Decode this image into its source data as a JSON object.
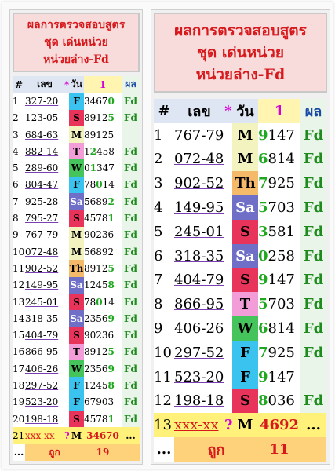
{
  "left": {
    "title_lines": [
      "ผลการตรวจสอบสูตร",
      "ชุด เด่นหน่วย",
      "หน่วยล่าง-Fd"
    ],
    "headers": {
      "no": "#",
      "lek": "เลข",
      "star": "*",
      "wan": "วัน",
      "num": "1",
      "pl": "ผล"
    },
    "rows": [
      {
        "no": "1",
        "lek": "327-20",
        "day": "F",
        "res_pre": "3467",
        "res_hit": "0",
        "res_post": "",
        "hit_color": "g",
        "pl": "Fd"
      },
      {
        "no": "2",
        "lek": "123-05",
        "day": "S",
        "res_pre": "8912",
        "res_hit": "5",
        "res_post": "",
        "hit_color": "g",
        "pl": "Fd"
      },
      {
        "no": "3",
        "lek": "684-63",
        "day": "M",
        "res_pre": "89125",
        "res_hit": "",
        "res_post": "",
        "hit_color": "g",
        "pl": ""
      },
      {
        "no": "4",
        "lek": "882-14",
        "day": "T",
        "res_pre": "1",
        "res_hit": "2",
        "res_post": "458",
        "hit_color": "g",
        "pl": "Fd"
      },
      {
        "no": "5",
        "lek": "289-60",
        "day": "W",
        "res_pre": "0",
        "res_hit": "1",
        "res_post": "347",
        "hit_color": "g",
        "pl": "Fd"
      },
      {
        "no": "6",
        "lek": "804-47",
        "day": "F",
        "res_pre": "78",
        "res_hit": "0",
        "res_post": "14",
        "hit_color": "g",
        "pl": "Fd"
      },
      {
        "no": "7",
        "lek": "925-28",
        "day": "Sa",
        "res_pre": "5689",
        "res_hit": "2",
        "res_post": "",
        "hit_color": "g",
        "pl": "Fd"
      },
      {
        "no": "8",
        "lek": "795-27",
        "day": "S",
        "res_pre": "4578",
        "res_hit": "1",
        "res_post": "",
        "hit_color": "g",
        "pl": "Fd"
      },
      {
        "no": "9",
        "lek": "767-79",
        "day": "M",
        "res_pre": "90236",
        "res_hit": "",
        "res_post": "",
        "hit_color": "g",
        "pl": "Fd"
      },
      {
        "no": "10",
        "lek": "072-48",
        "day": "M",
        "res_pre": "56892",
        "res_hit": "",
        "res_post": "",
        "hit_color": "g",
        "pl": "Fd"
      },
      {
        "no": "11",
        "lek": "902-52",
        "day": "Th",
        "res_pre": "8912",
        "res_hit": "5",
        "res_post": "",
        "hit_color": "g",
        "pl": "Fd"
      },
      {
        "no": "12",
        "lek": "149-95",
        "day": "Sa",
        "res_pre": "1245",
        "res_hit": "8",
        "res_post": "",
        "hit_color": "g",
        "pl": "Fd"
      },
      {
        "no": "13",
        "lek": "245-01",
        "day": "S",
        "res_pre": "78",
        "res_hit": "0",
        "res_post": "14",
        "hit_color": "g",
        "pl": "Fd"
      },
      {
        "no": "14",
        "lek": "318-35",
        "day": "Sa",
        "res_pre": "2356",
        "res_hit": "9",
        "res_post": "",
        "hit_color": "g",
        "pl": "Fd"
      },
      {
        "no": "15",
        "lek": "404-79",
        "day": "S",
        "res_pre": "90236",
        "res_hit": "",
        "res_post": "",
        "hit_color": "g",
        "pl": "Fd"
      },
      {
        "no": "16",
        "lek": "866-95",
        "day": "T",
        "res_pre": "8912",
        "res_hit": "5",
        "res_post": "",
        "hit_color": "g",
        "pl": "Fd"
      },
      {
        "no": "17",
        "lek": "406-26",
        "day": "W",
        "res_pre": "2356",
        "res_hit": "9",
        "res_post": "",
        "hit_color": "g",
        "pl": "Fd"
      },
      {
        "no": "18",
        "lek": "297-52",
        "day": "F",
        "res_pre": "1245",
        "res_hit": "8",
        "res_post": "",
        "hit_color": "g",
        "pl": "Fd"
      },
      {
        "no": "19",
        "lek": "523-20",
        "day": "F",
        "res_pre": "67903",
        "res_hit": "",
        "res_post": "",
        "hit_color": "g",
        "pl": "Fd"
      },
      {
        "no": "20",
        "lek": "198-18",
        "day": "S",
        "res_pre": "4578",
        "res_hit": "1",
        "res_post": "",
        "hit_color": "g",
        "pl": "Fd"
      }
    ],
    "current": {
      "no": "21",
      "lek": "xxx-xx",
      "q": "?",
      "day": "M",
      "res": "34670",
      "pl": "..."
    },
    "footer": {
      "dots": "...",
      "label": "ถูก",
      "count": "19"
    }
  },
  "right": {
    "title_lines": [
      "ผลการตรวจสอบสูตร",
      "ชุด เด่นหน่วย",
      "หน่วยล่าง-Fd"
    ],
    "headers": {
      "no": "#",
      "lek": "เลข",
      "star": "*",
      "wan": "วัน",
      "num": "1",
      "pl": "ผล"
    },
    "rows": [
      {
        "no": "1",
        "lek": "767-79",
        "day": "M",
        "res_pre": "9147",
        "pl": "Fd"
      },
      {
        "no": "2",
        "lek": "072-48",
        "day": "M",
        "res_pre": "6814",
        "pl": "Fd"
      },
      {
        "no": "3",
        "lek": "902-52",
        "day": "Th",
        "res_pre": "7925",
        "pl": "Fd"
      },
      {
        "no": "4",
        "lek": "149-95",
        "day": "Sa",
        "res_pre": "5703",
        "pl": "Fd"
      },
      {
        "no": "5",
        "lek": "245-01",
        "day": "S",
        "res_pre": "3581",
        "pl": "Fd"
      },
      {
        "no": "6",
        "lek": "318-35",
        "day": "Sa",
        "res_pre": "0258",
        "pl": "Fd"
      },
      {
        "no": "7",
        "lek": "404-79",
        "day": "S",
        "res_pre": "9147",
        "pl": "Fd"
      },
      {
        "no": "8",
        "lek": "866-95",
        "day": "T",
        "res_pre": "5703",
        "pl": "Fd"
      },
      {
        "no": "9",
        "lek": "406-26",
        "day": "W",
        "res_pre": "6814",
        "pl": "Fd"
      },
      {
        "no": "10",
        "lek": "297-52",
        "day": "F",
        "res_pre": "7925",
        "pl": "Fd"
      },
      {
        "no": "11",
        "lek": "523-20",
        "day": "F",
        "res_pre": "9147",
        "pl": ""
      },
      {
        "no": "12",
        "lek": "198-18",
        "day": "S",
        "res_pre": "8036",
        "pl": "Fd"
      }
    ],
    "current": {
      "no": "13",
      "lek": "xxx-xx",
      "q": "?",
      "day": "M",
      "res": "4692",
      "pl": "..."
    },
    "footer": {
      "dots": "...",
      "label": "ถูก",
      "count": "11"
    }
  }
}
